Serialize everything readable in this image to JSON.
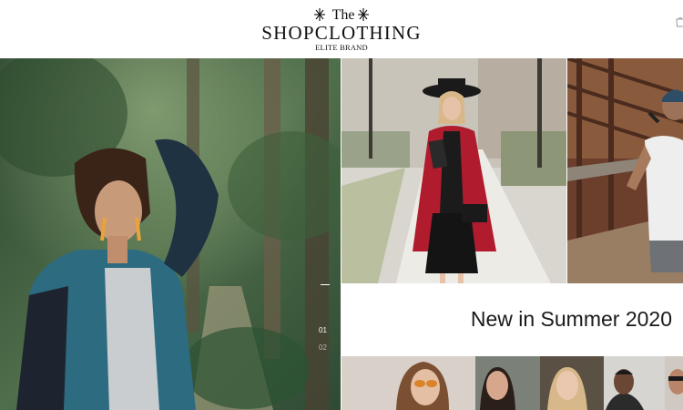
{
  "header": {
    "logo_the": "The",
    "logo_main": "SHOPCLOTHING",
    "logo_sub": "ELITE BRAND",
    "icons": [
      "sparkle-left-icon",
      "sparkle-right-icon",
      "cart-icon"
    ]
  },
  "hero": {
    "image": "woman-blue-blazer-forest-photo",
    "slides": [
      "01",
      "02"
    ],
    "active_slide": "01"
  },
  "promo": {
    "title": "New in Summer 2020"
  },
  "gallery": {
    "images": [
      "street-red-coat-photo",
      "bridge-man-white-tee-photo"
    ],
    "thumbnails": [
      "woman-sunglasses-thumb",
      "woman-portrait-thumb",
      "blonde-woman-thumb",
      "man-jacket-thumb",
      "man-sunglasses-thumb"
    ]
  },
  "colors": {
    "background": "#ffffff",
    "text": "#111111",
    "coat_red": "#b01c2e",
    "blazer_teal": "#2d6b80"
  }
}
